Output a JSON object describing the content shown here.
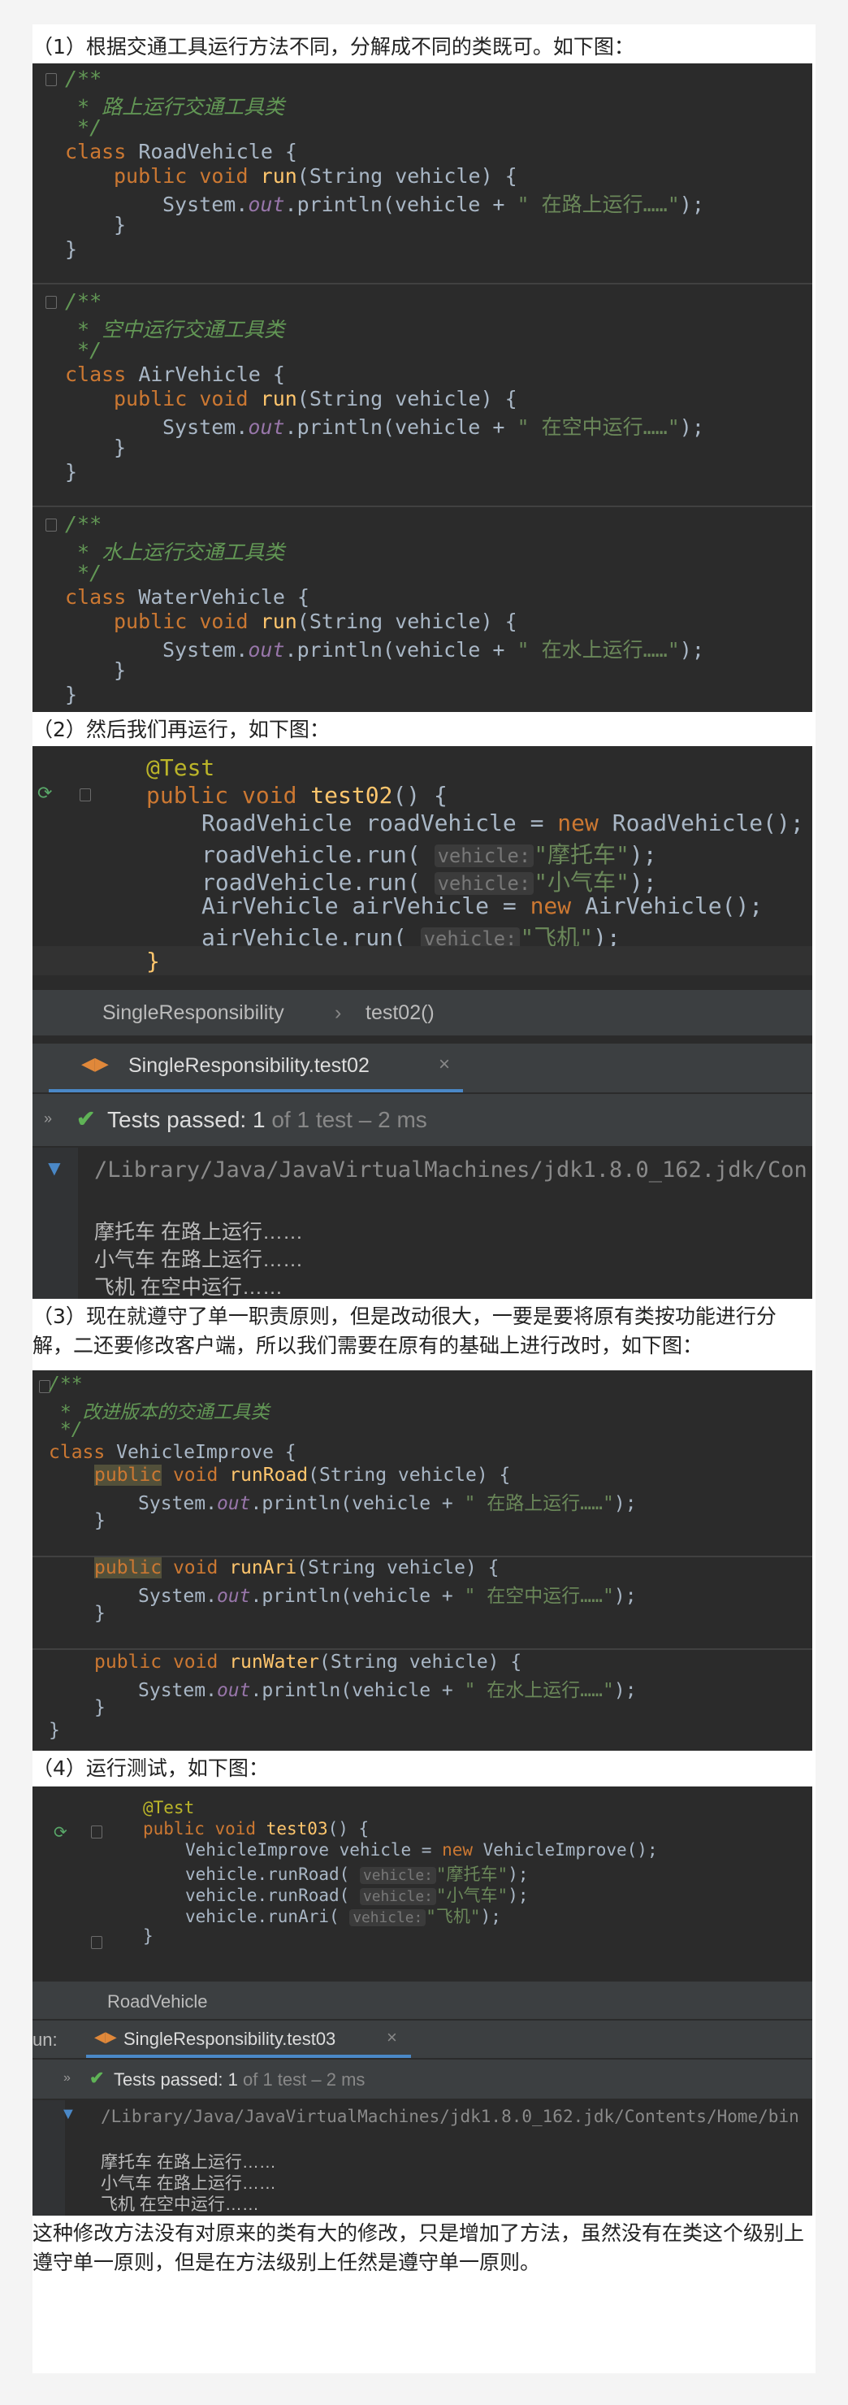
{
  "step1": {
    "text": "（1）根据交通工具运行方法不同，分解成不同的类既可。如下图：",
    "code": {
      "comment_open": "/**",
      "comment_close": " */",
      "road_comment": " * 路上运行交通工具类",
      "air_comment": " * 空中运行交通工具类",
      "water_comment": " * 水上运行交通工具类",
      "kw_class": "class",
      "road_class": " RoadVehicle {",
      "air_class": " AirVehicle {",
      "water_class": " WaterVehicle {",
      "kw_public_void": "public void",
      "method_run": "run",
      "params": "(String vehicle) {",
      "println_a": "System.",
      "println_b": "out",
      "println_c": ".println(vehicle + ",
      "road_str": "\" 在路上运行……\"",
      "air_str": "\" 在空中运行……\"",
      "water_str": "\" 在水上运行……\"",
      "end_stmt": ");",
      "close_brace": "}"
    }
  },
  "step2": {
    "text": "（2）然后我们再运行，如下图：",
    "code": {
      "annotation": "@Test",
      "kw_public_void": "public void",
      "method": "test02",
      "sig_rest": "() {",
      "l1_a": "RoadVehicle roadVehicle = ",
      "kw_new": "new",
      "l1_b": " RoadVehicle();",
      "l2_a": "roadVehicle.run(",
      "hint": "vehicle:",
      "l2_str": "\"摩托车\"",
      "l3_str": "\"小气车\"",
      "l4_a": "AirVehicle airVehicle = ",
      "l4_b": " AirVehicle();",
      "l5_a": "airVehicle.run(",
      "l5_str": "\"飞机\"",
      "end": ");",
      "close": "}"
    },
    "breadcrumb": {
      "class": "SingleResponsibility",
      "sep": "›",
      "method": "test02()"
    },
    "tab": "SingleResponsibility.test02",
    "tests": {
      "passed_label": "Tests passed:",
      "passed_count": "1",
      "rest": " of 1 test – 2 ms"
    },
    "path": "/Library/Java/JavaVirtualMachines/jdk1.8.0_162.jdk/Con",
    "output": [
      "摩托车  在路上运行……",
      "小气车  在路上运行……",
      "飞机  在空中运行……"
    ]
  },
  "step3": {
    "text": "（3）现在就遵守了单一职责原则，但是改动很大，一要是要将原有类按功能进行分解，二还要修改客户端，所以我们需要在原有的基础上进行改时，如下图：",
    "code": {
      "comment_open": "/**",
      "comment": " * 改进版本的交通工具类",
      "comment_close": " */",
      "kw_class": "class",
      "class_rest": " VehicleImprove {",
      "kw_public": "public",
      "kw_void": " void ",
      "m1": "runRoad",
      "m2": "runAri",
      "m3": "runWater",
      "params": "(String vehicle) {",
      "println_a": "System.",
      "println_b": "out",
      "println_c": ".println(vehicle + ",
      "road_str": "\" 在路上运行……\"",
      "air_str": "\" 在空中运行……\"",
      "water_str": "\" 在水上运行……\"",
      "end_stmt": ");",
      "close_brace": "}"
    }
  },
  "step4": {
    "text": "（4）运行测试，如下图：",
    "code": {
      "annotation": "@Test",
      "kw_public_void": "public void",
      "method": "test03",
      "sig_rest": "() {",
      "l1_a": "VehicleImprove vehicle = ",
      "kw_new": "new",
      "l1_b": " VehicleImprove();",
      "l2_a": "vehicle.runRoad(",
      "hint": "vehicle:",
      "l2_str": "\"摩托车\"",
      "l3_str": "\"小气车\"",
      "l4_a": "vehicle.runAri(",
      "l4_str": "\"飞机\"",
      "end": ");",
      "close": "}"
    },
    "breadcrumb": "RoadVehicle",
    "run_label": "un:",
    "tab": "SingleResponsibility.test03",
    "tests": {
      "passed_label": "Tests passed:",
      "passed_count": "1",
      "rest": " of 1 test – 2 ms"
    },
    "path": "/Library/Java/JavaVirtualMachines/jdk1.8.0_162.jdk/Contents/Home/bin",
    "output": [
      "摩托车  在路上运行……",
      "小气车  在路上运行……",
      "飞机  在空中运行……"
    ]
  },
  "conclusion": "这种修改方法没有对原来的类有大的修改，只是增加了方法，虽然没有在类这个级别上遵守单一原则，但是在方法级别上任然是遵守单一原则。",
  "colors": {
    "editor_bg": "#2b2b2b",
    "keyword": "#cc7832",
    "method": "#ffc66d",
    "string": "#6a8759",
    "comment": "#629755",
    "pass": "#5fb356"
  }
}
